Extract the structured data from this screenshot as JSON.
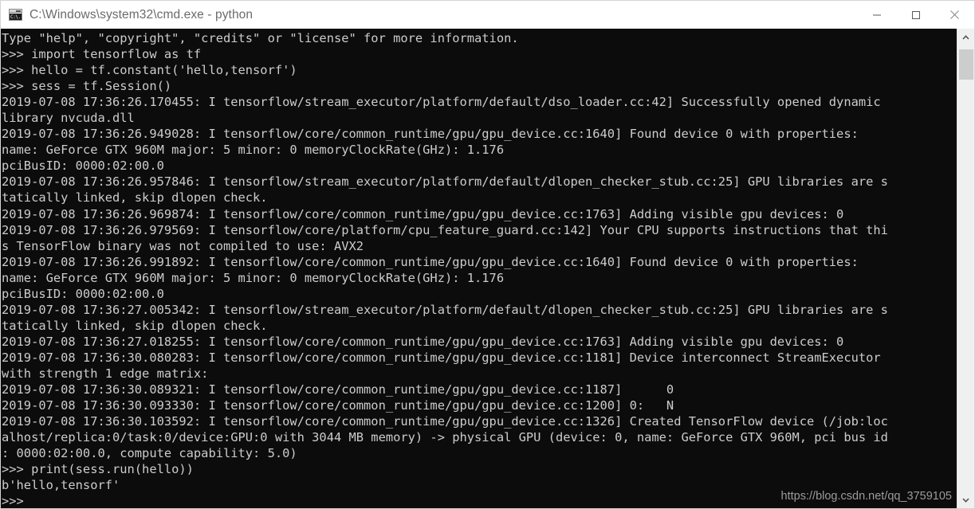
{
  "window": {
    "title": "C:\\Windows\\system32\\cmd.exe - python",
    "icon_glyph": "C:\\.",
    "icon_name": "cmd-console-icon",
    "background_color": "#0c0c0c",
    "text_color": "#cccccc",
    "titlebar_color": "#ffffff",
    "title_text_color": "#6b6b6b"
  },
  "controls": {
    "minimize_label": "Minimize",
    "maximize_label": "Maximize",
    "close_label": "Close"
  },
  "scrollbar": {
    "up_arrow": "˄",
    "down_arrow": "˅",
    "thumb_position_percent": 4,
    "track_color": "#f0f0f0",
    "thumb_color": "#cdcdcd"
  },
  "watermark": {
    "text": "https://blog.csdn.net/qq_3759105"
  },
  "console": {
    "lines": [
      "Type \"help\", \"copyright\", \"credits\" or \"license\" for more information.",
      ">>> import tensorflow as tf",
      ">>> hello = tf.constant('hello,tensorf')",
      ">>> sess = tf.Session()",
      "2019-07-08 17:36:26.170455: I tensorflow/stream_executor/platform/default/dso_loader.cc:42] Successfully opened dynamic",
      "library nvcuda.dll",
      "2019-07-08 17:36:26.949028: I tensorflow/core/common_runtime/gpu/gpu_device.cc:1640] Found device 0 with properties:",
      "name: GeForce GTX 960M major: 5 minor: 0 memoryClockRate(GHz): 1.176",
      "pciBusID: 0000:02:00.0",
      "2019-07-08 17:36:26.957846: I tensorflow/stream_executor/platform/default/dlopen_checker_stub.cc:25] GPU libraries are s",
      "tatically linked, skip dlopen check.",
      "2019-07-08 17:36:26.969874: I tensorflow/core/common_runtime/gpu/gpu_device.cc:1763] Adding visible gpu devices: 0",
      "2019-07-08 17:36:26.979569: I tensorflow/core/platform/cpu_feature_guard.cc:142] Your CPU supports instructions that thi",
      "s TensorFlow binary was not compiled to use: AVX2",
      "2019-07-08 17:36:26.991892: I tensorflow/core/common_runtime/gpu/gpu_device.cc:1640] Found device 0 with properties:",
      "name: GeForce GTX 960M major: 5 minor: 0 memoryClockRate(GHz): 1.176",
      "pciBusID: 0000:02:00.0",
      "2019-07-08 17:36:27.005342: I tensorflow/stream_executor/platform/default/dlopen_checker_stub.cc:25] GPU libraries are s",
      "tatically linked, skip dlopen check.",
      "2019-07-08 17:36:27.018255: I tensorflow/core/common_runtime/gpu/gpu_device.cc:1763] Adding visible gpu devices: 0",
      "2019-07-08 17:36:30.080283: I tensorflow/core/common_runtime/gpu/gpu_device.cc:1181] Device interconnect StreamExecutor",
      "with strength 1 edge matrix:",
      "2019-07-08 17:36:30.089321: I tensorflow/core/common_runtime/gpu/gpu_device.cc:1187]      0",
      "2019-07-08 17:36:30.093330: I tensorflow/core/common_runtime/gpu/gpu_device.cc:1200] 0:   N",
      "2019-07-08 17:36:30.103592: I tensorflow/core/common_runtime/gpu/gpu_device.cc:1326] Created TensorFlow device (/job:loc",
      "alhost/replica:0/task:0/device:GPU:0 with 3044 MB memory) -> physical GPU (device: 0, name: GeForce GTX 960M, pci bus id",
      ": 0000:02:00.0, compute capability: 5.0)",
      ">>> print(sess.run(hello))",
      "b'hello,tensorf'",
      ">>>"
    ]
  }
}
